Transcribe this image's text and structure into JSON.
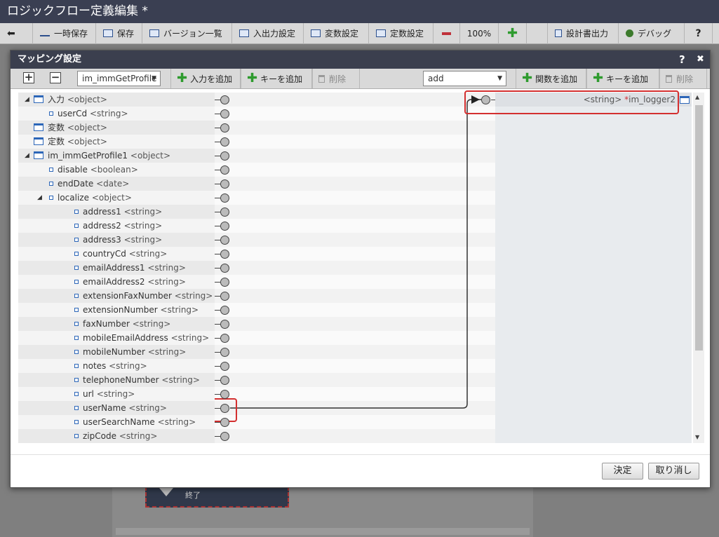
{
  "app": {
    "title": "ロジックフロー定義編集 *",
    "toolbar": {
      "back_icon": "arrow-left-icon",
      "temp_save": "一時保存",
      "save": "保存",
      "version_list": "バージョン一覧",
      "io_settings": "入出力設定",
      "var_settings": "変数設定",
      "const_settings": "定数設定",
      "zoom": "100%",
      "spec_export": "設計書出力",
      "debug": "デバッグ",
      "help": "?"
    },
    "canvas_node_label": "終了"
  },
  "dialog": {
    "title": "マッピング設定",
    "help": "?",
    "close": "✖",
    "toolbar": {
      "expand": "+",
      "collapse": "−",
      "source_select": "im_immGetProfile",
      "add_input": "入力を追加",
      "add_key_left": "キーを追加",
      "delete_left": "削除",
      "function_select": "add",
      "add_function": "関数を追加",
      "add_key_right": "キーを追加",
      "delete_right": "削除"
    },
    "source_tree": [
      {
        "label": "入力",
        "type": "<object>",
        "depth": 0,
        "kind": "object",
        "toggle": "◢"
      },
      {
        "label": "userCd",
        "type": "<string>",
        "depth": 1,
        "kind": "leaf"
      },
      {
        "label": "変数",
        "type": "<object>",
        "depth": 0,
        "kind": "object"
      },
      {
        "label": "定数",
        "type": "<object>",
        "depth": 0,
        "kind": "object"
      },
      {
        "label": "im_immGetProfile1",
        "type": "<object>",
        "depth": 0,
        "kind": "object",
        "toggle": "◢"
      },
      {
        "label": "disable",
        "type": "<boolean>",
        "depth": 1,
        "kind": "leaf"
      },
      {
        "label": "endDate",
        "type": "<date>",
        "depth": 1,
        "kind": "leaf"
      },
      {
        "label": "localize",
        "type": "<object>",
        "depth": 1,
        "kind": "leaf",
        "toggle": "◢"
      },
      {
        "label": "address1",
        "type": "<string>",
        "depth": 2,
        "kind": "leaf"
      },
      {
        "label": "address2",
        "type": "<string>",
        "depth": 2,
        "kind": "leaf"
      },
      {
        "label": "address3",
        "type": "<string>",
        "depth": 2,
        "kind": "leaf"
      },
      {
        "label": "countryCd",
        "type": "<string>",
        "depth": 2,
        "kind": "leaf"
      },
      {
        "label": "emailAddress1",
        "type": "<string>",
        "depth": 2,
        "kind": "leaf"
      },
      {
        "label": "emailAddress2",
        "type": "<string>",
        "depth": 2,
        "kind": "leaf"
      },
      {
        "label": "extensionFaxNumber",
        "type": "<string>",
        "depth": 2,
        "kind": "leaf"
      },
      {
        "label": "extensionNumber",
        "type": "<string>",
        "depth": 2,
        "kind": "leaf"
      },
      {
        "label": "faxNumber",
        "type": "<string>",
        "depth": 2,
        "kind": "leaf"
      },
      {
        "label": "mobileEmailAddress",
        "type": "<string>",
        "depth": 2,
        "kind": "leaf"
      },
      {
        "label": "mobileNumber",
        "type": "<string>",
        "depth": 2,
        "kind": "leaf"
      },
      {
        "label": "notes",
        "type": "<string>",
        "depth": 2,
        "kind": "leaf"
      },
      {
        "label": "telephoneNumber",
        "type": "<string>",
        "depth": 2,
        "kind": "leaf"
      },
      {
        "label": "url",
        "type": "<string>",
        "depth": 2,
        "kind": "leaf"
      },
      {
        "label": "userName",
        "type": "<string>",
        "depth": 2,
        "kind": "leaf",
        "highlight": true
      },
      {
        "label": "userSearchName",
        "type": "<string>",
        "depth": 2,
        "kind": "leaf"
      },
      {
        "label": "zipCode",
        "type": "<string>",
        "depth": 2,
        "kind": "leaf"
      }
    ],
    "target": {
      "type": "<string>",
      "required_mark": "*",
      "name": "im_logger2"
    },
    "footer": {
      "ok": "決定",
      "cancel": "取り消し"
    }
  },
  "colors": {
    "highlight": "#d32f2f",
    "header_bg": "#3b3f4e",
    "add_green": "#2e9b2e"
  }
}
